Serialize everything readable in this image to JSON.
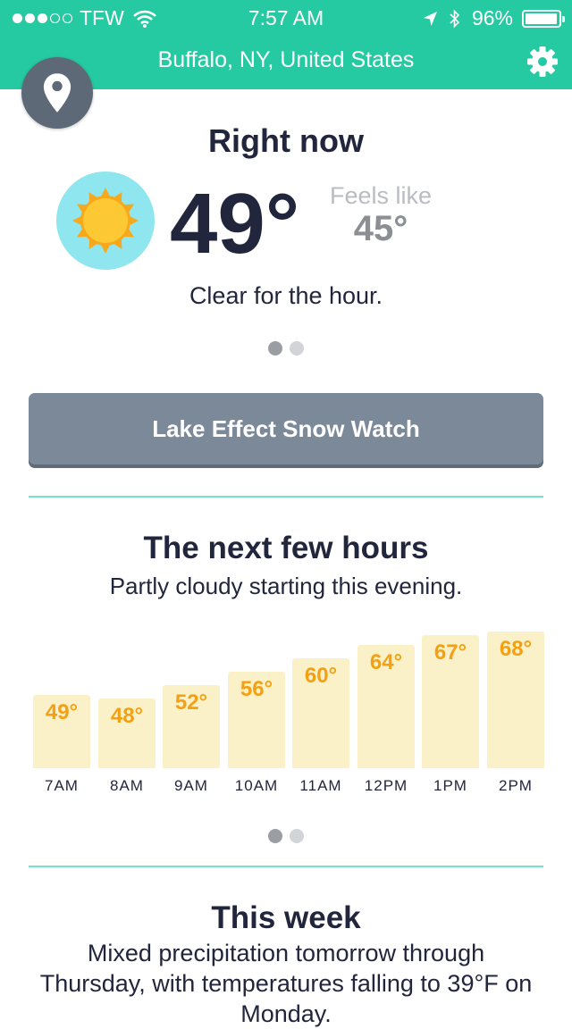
{
  "status_bar": {
    "carrier": "TFW",
    "time": "7:57 AM",
    "battery": "96%",
    "battery_level": 0.96,
    "signal_bars_filled": 3,
    "signal_bars_total": 5
  },
  "header": {
    "location": "Buffalo, NY, United States"
  },
  "right_now": {
    "heading": "Right now",
    "temperature": "49°",
    "feels_like_label": "Feels like",
    "feels_like_value": "45°",
    "summary": "Clear for the hour.",
    "icon": "sun-icon"
  },
  "alert": {
    "label": "Lake Effect Snow Watch"
  },
  "next_hours": {
    "heading": "The next few hours",
    "summary": "Partly cloudy starting this evening."
  },
  "chart_data": {
    "type": "bar",
    "categories": [
      "7AM",
      "8AM",
      "9AM",
      "10AM",
      "11AM",
      "12PM",
      "1PM",
      "2PM"
    ],
    "values": [
      49,
      48,
      52,
      56,
      60,
      64,
      67,
      68
    ],
    "value_labels": [
      "49°",
      "48°",
      "52°",
      "56°",
      "60°",
      "64°",
      "67°",
      "68°"
    ],
    "title": "",
    "xlabel": "",
    "ylabel": ""
  },
  "this_week": {
    "heading": "This week",
    "summary": "Mixed precipitation tomorrow through Thursday, with temperatures falling to 39°F on Monday."
  },
  "pagers": {
    "right_now_active": 0,
    "hours_active": 0,
    "count": 2
  },
  "colors": {
    "accent": "#25c9a2",
    "alert": "#7b8998",
    "bar_fill": "#fbf1c9",
    "bar_label": "#f4a012",
    "sun": "#fbc531",
    "sun_badge": "#8fe6ee"
  }
}
